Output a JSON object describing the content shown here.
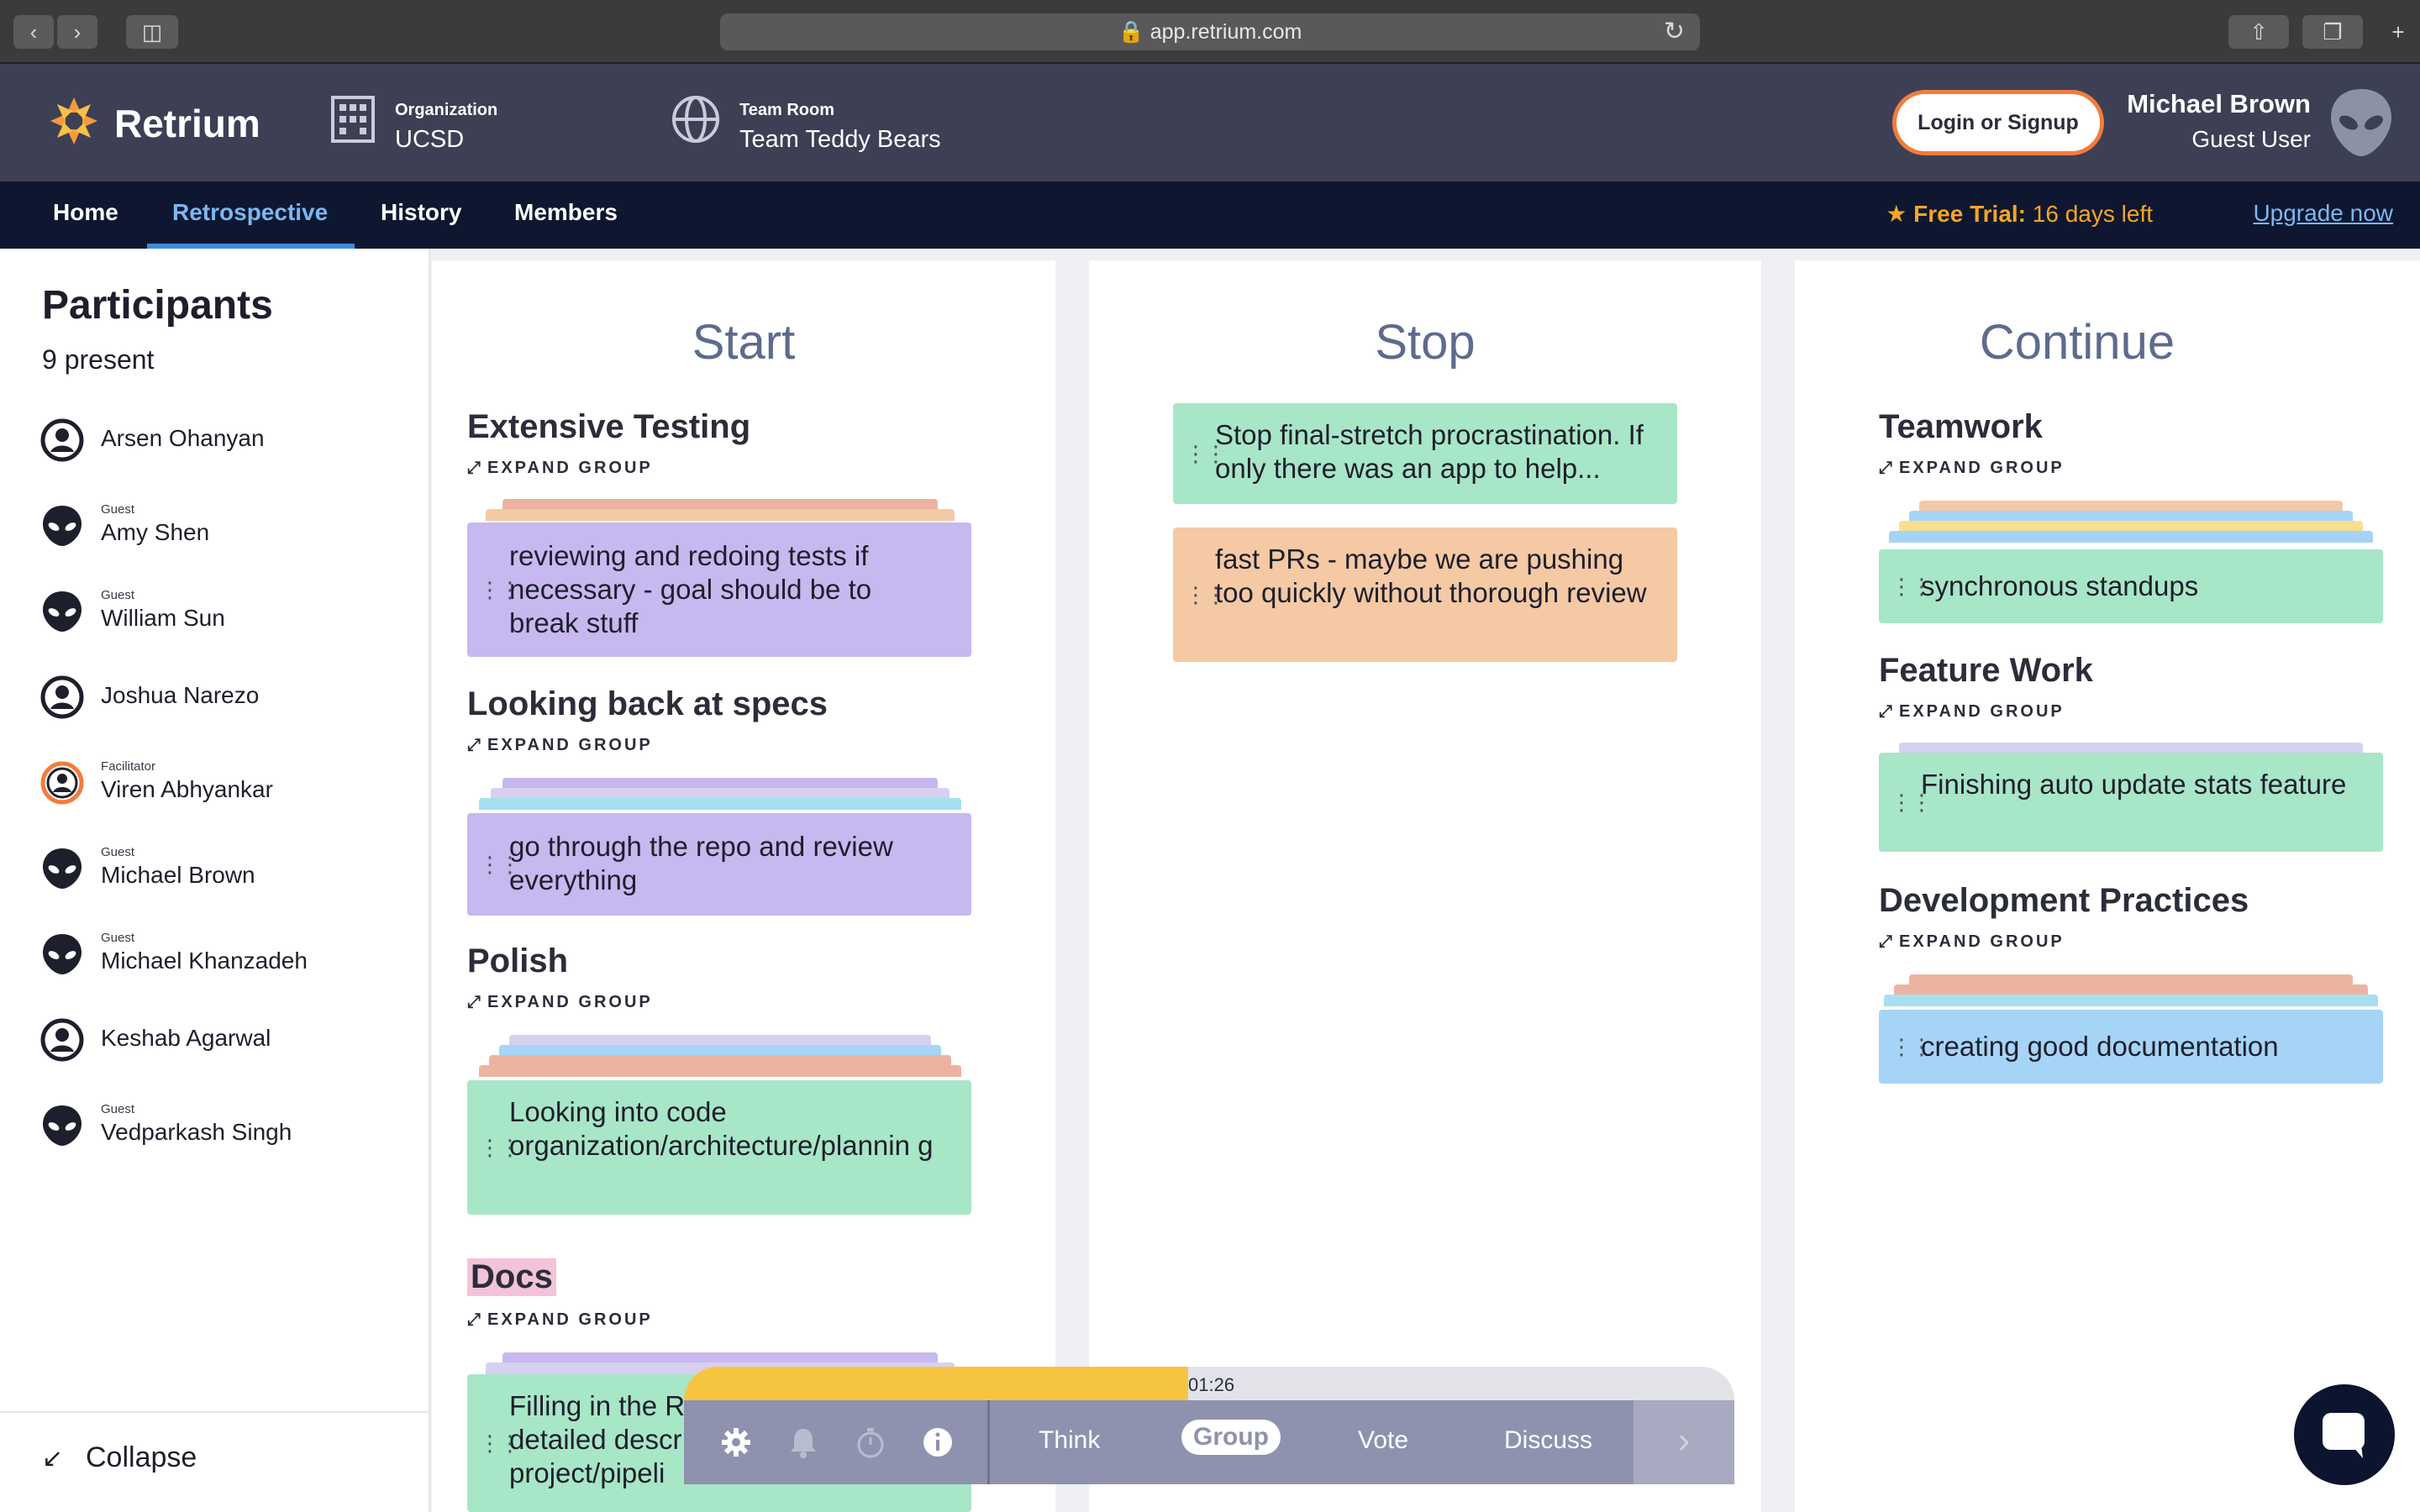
{
  "browser": {
    "url": "app.retrium.com",
    "back_icon": "chevron-left-icon",
    "forward_icon": "chevron-right-icon"
  },
  "header": {
    "brand": "Retrium",
    "organization_label": "Organization",
    "organization_value": "UCSD",
    "team_room_label": "Team Room",
    "team_room_value": "Team Teddy Bears",
    "login_label": "Login or Signup",
    "user_name": "Michael Brown",
    "user_role": "Guest User"
  },
  "nav": {
    "items": [
      "Home",
      "Retrospective",
      "History",
      "Members"
    ],
    "active": "Retrospective",
    "trial_label": "Free Trial:",
    "trial_value": "16 days left",
    "upgrade": "Upgrade now",
    "accent": "#f5a623"
  },
  "sidebar": {
    "title": "Participants",
    "count": "9 present",
    "participants": [
      {
        "name": "Arsen Ohanyan",
        "tag": "",
        "avatar": "user-icon"
      },
      {
        "name": "Amy Shen",
        "tag": "Guest",
        "avatar": "alien-icon"
      },
      {
        "name": "William Sun",
        "tag": "Guest",
        "avatar": "alien-icon"
      },
      {
        "name": "Joshua Narezo",
        "tag": "",
        "avatar": "user-icon"
      },
      {
        "name": "Viren Abhyankar",
        "tag": "Facilitator",
        "avatar": "user-icon"
      },
      {
        "name": "Michael Brown",
        "tag": "Guest",
        "avatar": "alien-icon"
      },
      {
        "name": "Michael Khanzadeh",
        "tag": "Guest",
        "avatar": "alien-icon"
      },
      {
        "name": "Keshab Agarwal",
        "tag": "",
        "avatar": "user-icon"
      },
      {
        "name": "Vedparkash Singh",
        "tag": "Guest",
        "avatar": "alien-icon"
      }
    ],
    "collapse": "Collapse"
  },
  "board": {
    "expand_label": "EXPAND GROUP",
    "columns": {
      "start": {
        "title": "Start",
        "groups": [
          {
            "title": "Extensive Testing",
            "card": "reviewing and redoing tests if necessary - goal should be to break stuff"
          },
          {
            "title": "Looking back at specs",
            "card": "go through the repo and review everything"
          },
          {
            "title": "Polish",
            "card": "Looking into code organization/architecture/plannin g"
          },
          {
            "title": "Docs",
            "card": "Filling in the R detailed descr project/pipeli"
          }
        ]
      },
      "stop": {
        "title": "Stop",
        "cards": [
          "Stop final-stretch procrastination. If only there was an app to help...",
          "fast PRs - maybe we are pushing too quickly without thorough review"
        ]
      },
      "continue": {
        "title": "Continue",
        "groups": [
          {
            "title": "Teamwork",
            "card": "synchronous standups"
          },
          {
            "title": "Feature Work",
            "card": "Finishing auto update stats feature"
          },
          {
            "title": "Development Practices",
            "card": "creating good documentation"
          }
        ]
      }
    },
    "colors": {
      "purple": "#c7b8ef",
      "green": "#a8e6c8",
      "orange": "#f4c9a4",
      "blue": "#a6d4f7",
      "salmon": "#ecb4a0",
      "yellow": "#f7df8e"
    }
  },
  "phase_bar": {
    "timer": "01:26",
    "timer_progress": 0.48,
    "phases": [
      "Think",
      "Group",
      "Vote",
      "Discuss"
    ],
    "active": "Group",
    "tools": [
      "gear-icon",
      "bell-icon",
      "stopwatch-icon",
      "info-icon"
    ]
  }
}
